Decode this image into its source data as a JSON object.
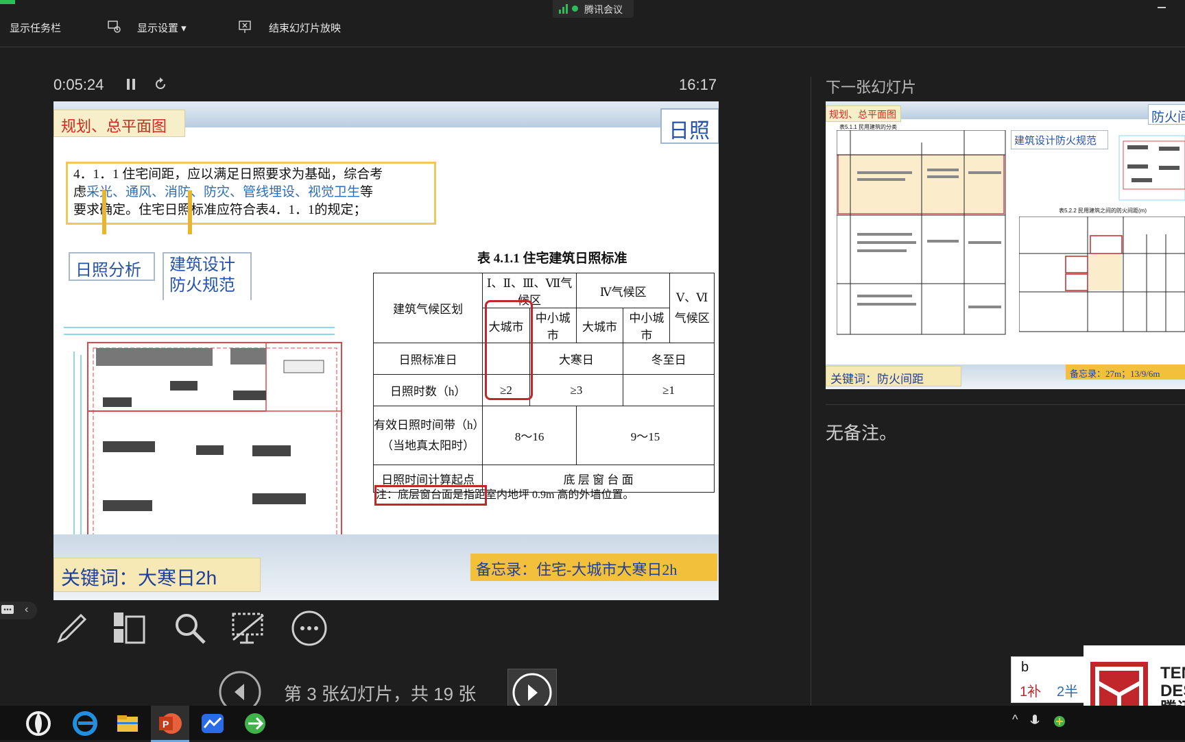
{
  "toolbar": {
    "show_taskbar": "显示任务栏",
    "display_settings": "显示设置 ▾",
    "end_slideshow": "结束幻灯片放映",
    "meeting_app": "腾讯会议"
  },
  "timer": {
    "elapsed": "0:05:24",
    "clock": "16:17"
  },
  "next_slide_heading": "下一张幻灯片",
  "notes_text": "无备注。",
  "slide_counter": "第 3 张幻灯片，共 19 张",
  "slide": {
    "category": "规划、总平面图",
    "topic": "日照",
    "clause_line1": "4．1．1 住宅间距，应以满足日照要求为基础，综合考",
    "clause_line2_a": "虑",
    "clause_line2_b": "采光、通风、消防、防灾、管线埋设、视觉卫生",
    "clause_line2_c": "等",
    "clause_line3": "要求确定。住宅日照标准应符合表4．1．1的规定；",
    "label_sun_analysis": "日照分析",
    "label_fire_code_1": "建筑设计",
    "label_fire_code_2": "防火规范",
    "table_title": "表 4.1.1 住宅建筑日照标准",
    "table": {
      "h_zone": "建筑气候区划",
      "h_zone_1_2_3_7": "Ⅰ、Ⅱ、Ⅲ、Ⅶ气候区",
      "h_zone_4": "Ⅳ气候区",
      "h_zone_5_6_a": "Ⅴ、Ⅵ",
      "h_zone_5_6_b": "气候区",
      "h_big_city": "大城市",
      "h_mid_city": "中小城市",
      "h_big_city_2": "大城市",
      "h_mid_city_2": "中小城市",
      "r1_label": "日照标准日",
      "r1_v1": "大寒日",
      "r1_v2": "冬至日",
      "r2_label": "日照时数（h）",
      "r2_v1": "≥2",
      "r2_v2": "≥3",
      "r2_v3": "≥1",
      "r3_label_a": "有效日照时间带（h）",
      "r3_label_b": "（当地真太阳时）",
      "r3_v1": "8～16",
      "r3_v2": "9～15",
      "r4_label": "日照时间计算起点",
      "r4_v1": "底 层 窗 台 面"
    },
    "note": "注：底层窗台面是指距室内地坪 0.9m 高的外墙位置。",
    "keyword": "关键词：大寒日2h",
    "memo": "备忘录：住宅-大城市大寒日2h"
  },
  "next_slide": {
    "category": "规划、总平面图",
    "topic": "防火间",
    "code_label": "建筑设计防火规范",
    "table1_title": "表5.1.1 民用建筑的分类",
    "table2_title": "表5.2.2 民用建筑之间的防火间距(m)",
    "keyword": "关键词：防火间距",
    "memo": "备忘录：27m；13/9/6m"
  },
  "ime": {
    "input": "b",
    "cand1": "1补",
    "cand2": "2半"
  },
  "logo_text": [
    "TEN",
    "DES",
    "腾讯"
  ],
  "colors": {
    "accent_red": "#c0262a",
    "accent_blue": "#2e6db5",
    "keyword_bg": "#f6e9b5",
    "memo_bg": "#f3c03c"
  }
}
